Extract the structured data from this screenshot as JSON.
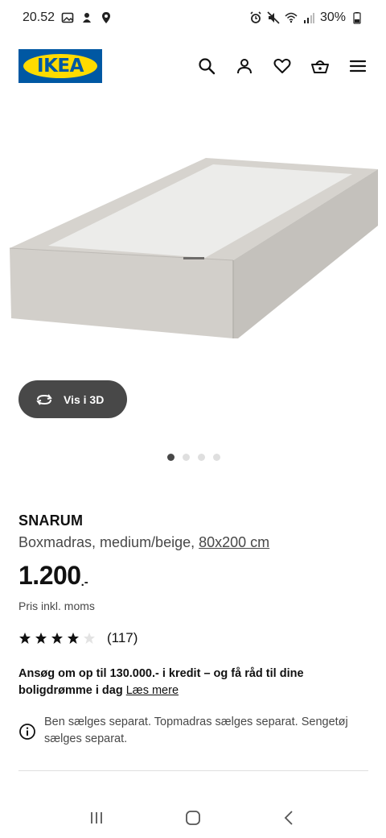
{
  "status_bar": {
    "time": "20.52",
    "battery": "30%"
  },
  "header": {
    "logo_text": "IKEA",
    "icons": [
      "search-icon",
      "profile-icon",
      "heart-icon",
      "basket-icon",
      "menu-icon"
    ]
  },
  "gallery": {
    "view_3d_label": "Vis i 3D",
    "dots_total": 4,
    "active_dot": 1
  },
  "product": {
    "name": "SNARUM",
    "description": "Boxmadras, medium/beige,",
    "size": "80x200 cm",
    "price": "1.200",
    "price_suffix": ".-",
    "price_note": "Pris inkl. moms",
    "rating": 4,
    "rating_max": 5,
    "review_count": "(117)"
  },
  "credit": {
    "text": "Ansøg om op til 130.000.- i kredit – og få råd til dine boligdrømme i dag",
    "link": "Læs mere"
  },
  "info": {
    "text": "Ben sælges separat. Topmadras sælges separat. Sengetøj sælges separat."
  },
  "colors": {
    "ikea_blue": "#0058a3",
    "ikea_yellow": "#ffdb00",
    "button_dark": "#484848"
  }
}
